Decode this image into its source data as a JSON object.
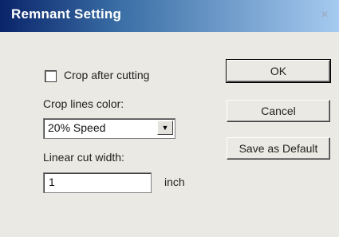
{
  "window": {
    "title": "Remnant Setting",
    "close_glyph": "×"
  },
  "options": {
    "crop_after_cutting_label": "Crop after cutting",
    "crop_after_cutting_checked": false,
    "crop_lines_color_label": "Crop lines color:",
    "crop_lines_color_value": "20% Speed",
    "linear_cut_width_label": "Linear cut width:",
    "linear_cut_width_value": "1",
    "unit_label": "inch"
  },
  "buttons": {
    "ok": "OK",
    "cancel": "Cancel",
    "save_default": "Save as Default"
  },
  "icons": {
    "dropdown": "chevron-down-icon",
    "close": "close-icon"
  }
}
